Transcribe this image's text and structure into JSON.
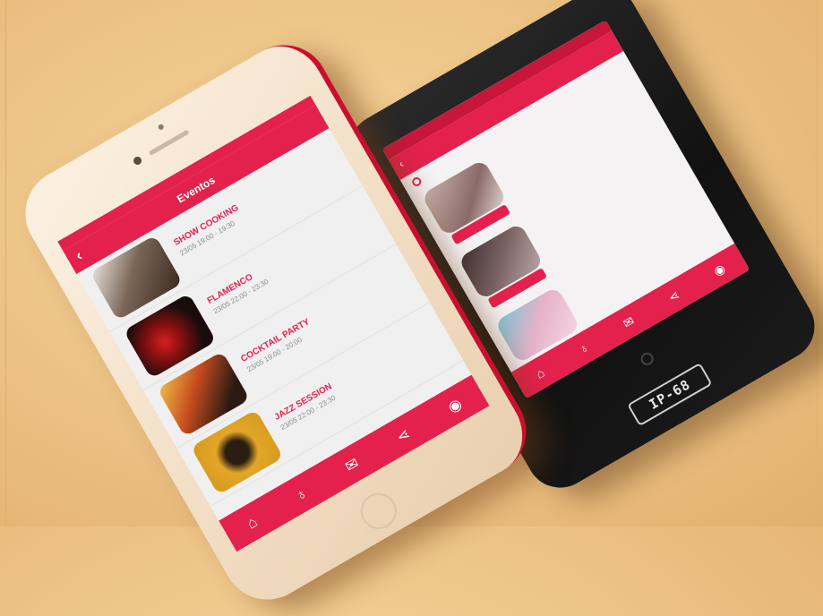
{
  "iphone": {
    "header_title": "Eventos",
    "back_icon": "chevron-left-icon",
    "events": [
      {
        "name": "SHOW COOKING",
        "time": "23/05 19:00 - 19:30",
        "thumb_color": "#7a6656"
      },
      {
        "name": "FLAMENCO",
        "time": "23/05 22:00 - 23:30",
        "thumb_color": "#b01e1e"
      },
      {
        "name": "COCKTAIL PARTY",
        "time": "23/05 19:00 - 20:00",
        "thumb_color": "#8a3a1e"
      },
      {
        "name": "JAZZ SESSION",
        "time": "23/05 22:00 - 23:30",
        "thumb_color": "#d49a1e"
      }
    ],
    "tabs": [
      {
        "icon": "bell-icon",
        "glyph": "⌂"
      },
      {
        "icon": "bottle-icon",
        "glyph": "♁"
      },
      {
        "icon": "chat-icon",
        "glyph": "✉"
      },
      {
        "icon": "share-icon",
        "glyph": "⋖"
      },
      {
        "icon": "location-icon",
        "glyph": "◉"
      }
    ]
  },
  "rugged": {
    "badge_text": "IP-68",
    "events": [
      {
        "thumb_color": "#b5a09a"
      },
      {
        "thumb_color": "#6b5a5a"
      },
      {
        "thumb_color": "#d9a8b8"
      }
    ],
    "tabs": [
      {
        "icon": "bell-icon",
        "glyph": "⌂"
      },
      {
        "icon": "bottle-icon",
        "glyph": "♁"
      },
      {
        "icon": "chat-icon",
        "glyph": "✉"
      },
      {
        "icon": "share-icon",
        "glyph": "⋖"
      },
      {
        "icon": "location-icon",
        "glyph": "◉"
      }
    ]
  },
  "colors": {
    "accent": "#e3214c",
    "background": "#eec588"
  }
}
